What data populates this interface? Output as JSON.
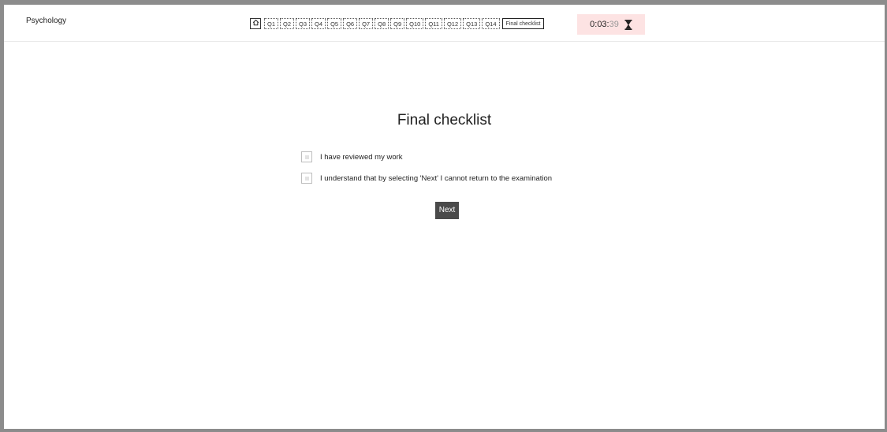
{
  "header": {
    "subject": "Psychology",
    "nav": {
      "questions": [
        "Q1",
        "Q2",
        "Q3",
        "Q4",
        "Q5",
        "Q6",
        "Q7",
        "Q8",
        "Q9",
        "Q10",
        "Q11",
        "Q12",
        "Q13",
        "Q14"
      ],
      "final_label": "Final checklist",
      "home_icon": "home-icon"
    },
    "timer": {
      "hm": "0:03:",
      "seconds": "39",
      "icon": "hourglass-icon",
      "background": "#fde3e3"
    }
  },
  "main": {
    "title": "Final checklist",
    "checklist": [
      {
        "label": "I have reviewed my work",
        "checked": false
      },
      {
        "label": "I understand that by selecting 'Next' I cannot return to the examination",
        "checked": false
      }
    ],
    "next_label": "Next"
  }
}
